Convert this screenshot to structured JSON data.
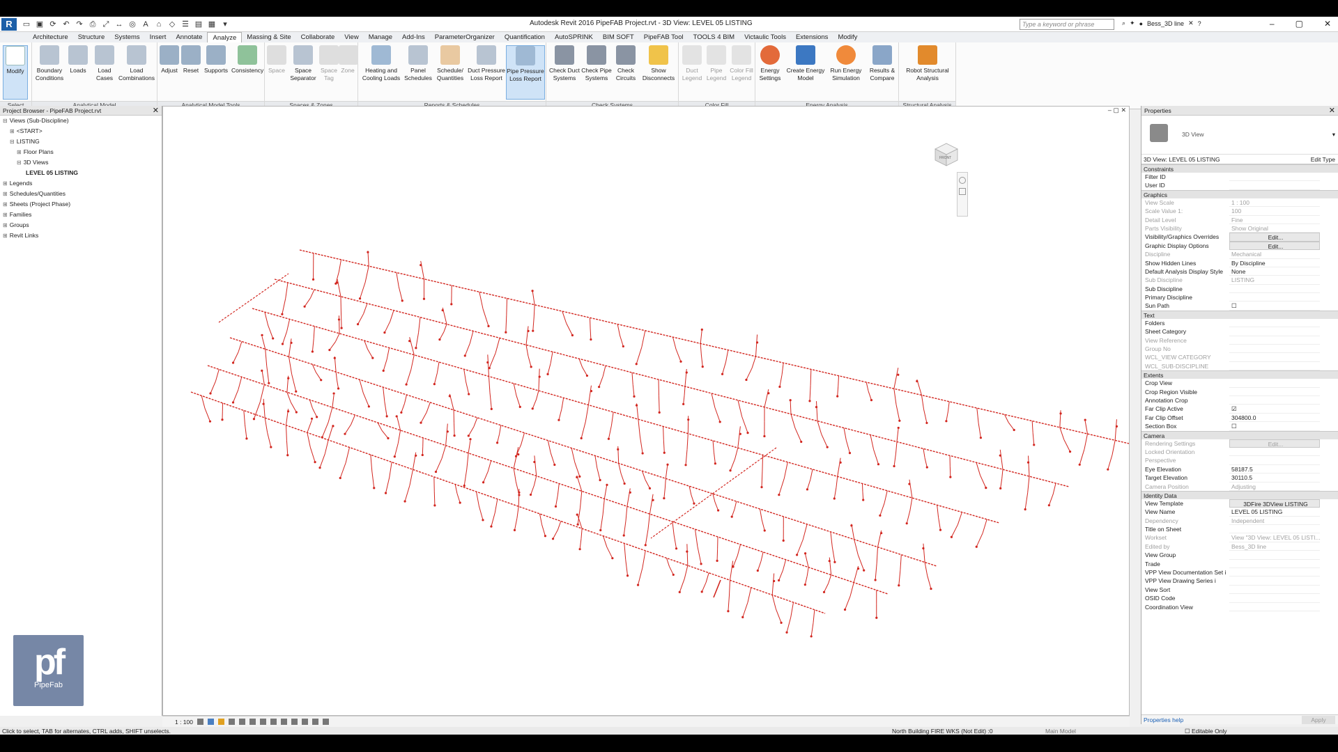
{
  "title_bar": {
    "window_title": "Autodesk Revit 2016    PipeFAB Project.rvt - 3D View: LEVEL 05 LISTING",
    "search_placeholder": "Type a keyword or phrase",
    "user_name": "Bess_3D line"
  },
  "menu_tabs": [
    "Architecture",
    "Structure",
    "Systems",
    "Insert",
    "Annotate",
    "Analyze",
    "Massing & Site",
    "Collaborate",
    "View",
    "Manage",
    "Add-Ins",
    "ParameterOrganizer",
    "Quantification",
    "AutoSPRINK",
    "BIM SOFT",
    "PipeFAB Tool",
    "TOOLS 4 BIM",
    "Victaulic Tools",
    "Extensions",
    "Modify"
  ],
  "active_tab": "Analyze",
  "ribbon": {
    "panels": [
      "Select",
      "Analytical Model",
      "Analytical Model Tools",
      "Spaces & Zones",
      "Reports & Schedules",
      "Check Systems",
      "Color Fill",
      "Energy Analysis",
      "Structural Analysis"
    ],
    "buttons": {
      "modify": "Modify",
      "boundary_conditions": "Boundary Conditions",
      "loads": "Loads",
      "load_cases": "Load Cases",
      "load_combinations": "Load Combinations",
      "adjust": "Adjust",
      "reset": "Reset",
      "supports": "Supports",
      "consistency": "Consistency",
      "space": "Space",
      "space_separator": "Space Separator",
      "space_tag": "Space Tag",
      "zone": "Zone",
      "heating_cooling": "Heating and Cooling Loads",
      "panel_schedules": "Panel Schedules",
      "schedule_quantities": "Schedule/ Quantities",
      "duct_pressure": "Duct Pressure Loss Report",
      "pipe_pressure": "Pipe Pressure Loss Report",
      "check_duct": "Check Duct Systems",
      "check_pipe": "Check Pipe Systems",
      "check_circuits": "Check Circuits",
      "show_disconnects": "Show Disconnects",
      "duct_legend": "Duct Legend",
      "pipe_legend": "Pipe Legend",
      "color_fill_legend": "Color Fill Legend",
      "energy_settings": "Energy Settings",
      "create_energy_model": "Create Energy Model",
      "run_energy_simulation": "Run Energy Simulation",
      "results_compare": "Results & Compare",
      "robot_structural": "Robot Structural Analysis"
    }
  },
  "project_browser": {
    "title": "Project Browser - PipeFAB Project.rvt",
    "items": [
      {
        "label": "Views (Sub-Discipline)",
        "depth": 0,
        "toggle": "⊟",
        "bold": false
      },
      {
        "label": "<START>",
        "depth": 1,
        "toggle": "⊞",
        "bold": false
      },
      {
        "label": "LISTING",
        "depth": 1,
        "toggle": "⊟",
        "bold": false
      },
      {
        "label": "Floor Plans",
        "depth": 2,
        "toggle": "⊞",
        "bold": false
      },
      {
        "label": "3D Views",
        "depth": 2,
        "toggle": "⊟",
        "bold": false
      },
      {
        "label": "LEVEL 05 LISTING",
        "depth": 3,
        "toggle": "",
        "bold": true
      },
      {
        "label": "Legends",
        "depth": 0,
        "toggle": "⊞",
        "bold": false
      },
      {
        "label": "Schedules/Quantities",
        "depth": 0,
        "toggle": "⊞",
        "bold": false
      },
      {
        "label": "Sheets (Project Phase)",
        "depth": 0,
        "toggle": "⊞",
        "bold": false
      },
      {
        "label": "Families",
        "depth": 0,
        "toggle": "⊞",
        "bold": false
      },
      {
        "label": "Groups",
        "depth": 0,
        "toggle": "⊞",
        "bold": false
      },
      {
        "label": "Revit Links",
        "depth": 0,
        "toggle": "⊞",
        "bold": false
      }
    ],
    "logo_mark": "pf",
    "logo_text": "PipeFab"
  },
  "viewport": {
    "scale": "1 : 100",
    "viewcube_label": "FRONT"
  },
  "properties": {
    "title": "Properties",
    "type_label": "3D View",
    "selector": "3D View: LEVEL 05 LISTING",
    "edit_type": "Edit Type",
    "groups": [
      {
        "name": "Constraints",
        "rows": [
          {
            "k": "Filter ID",
            "v": "",
            "dim": false,
            "btn": false
          },
          {
            "k": "User ID",
            "v": "",
            "dim": false,
            "btn": false
          }
        ]
      },
      {
        "name": "Graphics",
        "rows": [
          {
            "k": "View Scale",
            "v": "1 : 100",
            "dim": true,
            "btn": false
          },
          {
            "k": "Scale Value   1:",
            "v": "100",
            "dim": true,
            "btn": false
          },
          {
            "k": "Detail Level",
            "v": "Fine",
            "dim": true,
            "btn": false
          },
          {
            "k": "Parts Visibility",
            "v": "Show Original",
            "dim": true,
            "btn": false
          },
          {
            "k": "Visibility/Graphics Overrides",
            "v": "Edit...",
            "dim": false,
            "btn": true
          },
          {
            "k": "Graphic Display Options",
            "v": "Edit...",
            "dim": false,
            "btn": true
          },
          {
            "k": "Discipline",
            "v": "Mechanical",
            "dim": true,
            "btn": false
          },
          {
            "k": "Show Hidden Lines",
            "v": "By Discipline",
            "dim": false,
            "btn": false
          },
          {
            "k": "Default Analysis Display Style",
            "v": "None",
            "dim": false,
            "btn": false
          },
          {
            "k": "Sub Discipline",
            "v": "LISTING",
            "dim": true,
            "btn": false
          },
          {
            "k": "Sub Discipline",
            "v": "",
            "dim": false,
            "btn": false
          },
          {
            "k": "Primary Discipline",
            "v": "",
            "dim": false,
            "btn": false
          },
          {
            "k": "Sun Path",
            "v": "☐",
            "dim": false,
            "btn": false
          }
        ]
      },
      {
        "name": "Text",
        "rows": [
          {
            "k": "Folders",
            "v": "",
            "dim": false,
            "btn": false
          },
          {
            "k": "Sheet Category",
            "v": "",
            "dim": false,
            "btn": false
          },
          {
            "k": "View Reference",
            "v": "",
            "dim": true,
            "btn": false
          },
          {
            "k": "Group No",
            "v": "",
            "dim": true,
            "btn": false
          },
          {
            "k": "WCL_VIEW CATEGORY",
            "v": "",
            "dim": true,
            "btn": false
          },
          {
            "k": "WCL_SUB-DISCIPLINE",
            "v": "",
            "dim": true,
            "btn": false
          }
        ]
      },
      {
        "name": "Extents",
        "rows": [
          {
            "k": "Crop View",
            "v": "",
            "dim": false,
            "btn": false
          },
          {
            "k": "Crop Region Visible",
            "v": "",
            "dim": false,
            "btn": false
          },
          {
            "k": "Annotation Crop",
            "v": "",
            "dim": false,
            "btn": false
          },
          {
            "k": "Far Clip Active",
            "v": "☑",
            "dim": false,
            "btn": false
          },
          {
            "k": "Far Clip Offset",
            "v": "304800.0",
            "dim": false,
            "btn": false
          },
          {
            "k": "Section Box",
            "v": "☐",
            "dim": false,
            "btn": false
          }
        ]
      },
      {
        "name": "Camera",
        "rows": [
          {
            "k": "Rendering Settings",
            "v": "Edit...",
            "dim": true,
            "btn": true
          },
          {
            "k": "Locked Orientation",
            "v": "",
            "dim": true,
            "btn": false
          },
          {
            "k": "Perspective",
            "v": "",
            "dim": true,
            "btn": false
          },
          {
            "k": "Eye Elevation",
            "v": "58187.5",
            "dim": false,
            "btn": false
          },
          {
            "k": "Target Elevation",
            "v": "30110.5",
            "dim": false,
            "btn": false
          },
          {
            "k": "Camera Position",
            "v": "Adjusting",
            "dim": true,
            "btn": false
          }
        ]
      },
      {
        "name": "Identity Data",
        "rows": [
          {
            "k": "View Template",
            "v": "3DFire 3DView LISTING",
            "dim": false,
            "btn": true
          },
          {
            "k": "View Name",
            "v": "LEVEL 05 LISTING",
            "dim": false,
            "btn": false
          },
          {
            "k": "Dependency",
            "v": "Independent",
            "dim": true,
            "btn": false
          },
          {
            "k": "Title on Sheet",
            "v": "",
            "dim": false,
            "btn": false
          },
          {
            "k": "Workset",
            "v": "View \"3D View: LEVEL 05 LISTI...",
            "dim": true,
            "btn": false
          },
          {
            "k": "Edited by",
            "v": "Bess_3D line",
            "dim": true,
            "btn": false
          },
          {
            "k": "View Group",
            "v": "",
            "dim": false,
            "btn": false
          },
          {
            "k": "Trade",
            "v": "",
            "dim": false,
            "btn": false
          },
          {
            "k": "VPP View Documentation Set i",
            "v": "",
            "dim": false,
            "btn": false
          },
          {
            "k": "VPP View Drawing Series i",
            "v": "",
            "dim": false,
            "btn": false
          },
          {
            "k": "View Sort",
            "v": "",
            "dim": false,
            "btn": false
          },
          {
            "k": "OSID Code",
            "v": "",
            "dim": false,
            "btn": false
          },
          {
            "k": "Coordination View",
            "v": "",
            "dim": false,
            "btn": false
          }
        ]
      }
    ],
    "help_link": "Properties help",
    "apply_label": "Apply"
  },
  "status_bar": {
    "hint": "Click to select, TAB for alternates, CTRL adds, SHIFT unselects.",
    "workset": "North Building FIRE WKS (Not Edit)",
    "workset_count": ":0",
    "model": "Main Model",
    "editable": "Editable Only"
  },
  "colors": {
    "pipe": "#d2261f",
    "accent": "#1c5fa8",
    "logo_bg": "#7687a6"
  }
}
